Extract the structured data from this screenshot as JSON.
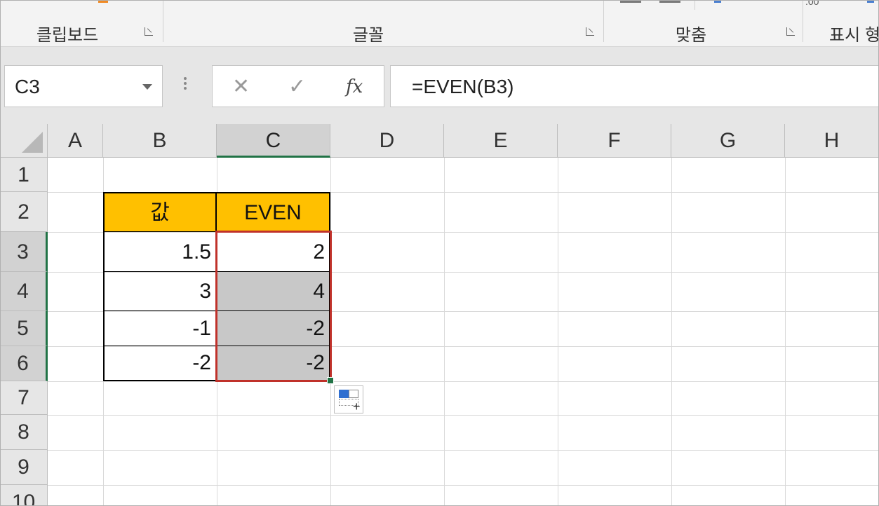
{
  "ribbon": {
    "groups": [
      {
        "label": "클립보드"
      },
      {
        "label": "글꼴"
      },
      {
        "label": "맞춤"
      },
      {
        "label": "표시 형"
      }
    ],
    "partial_text": ".00"
  },
  "formula_bar": {
    "name_box": "C3",
    "cancel_icon": "✕",
    "enter_icon": "✓",
    "fx_label": "fx",
    "formula": "=EVEN(B3)"
  },
  "columns": [
    "A",
    "B",
    "C",
    "D",
    "E",
    "F",
    "G",
    "H"
  ],
  "rows": [
    "1",
    "2",
    "3",
    "4",
    "5",
    "6",
    "7",
    "8",
    "9",
    "10"
  ],
  "table": {
    "headers": [
      "값",
      "EVEN"
    ],
    "values": [
      {
        "value": "1.5",
        "even": "2"
      },
      {
        "value": "3",
        "even": "4"
      },
      {
        "value": "-1",
        "even": "-2"
      },
      {
        "value": "-2",
        "even": "-2"
      }
    ]
  },
  "selection": {
    "active_cell": "C3",
    "range": "C3:C6"
  },
  "colors": {
    "header_fill": "#ffc000",
    "selection_border": "#c0312a",
    "selected_fill": "#c8c8c8",
    "excel_green": "#217346"
  }
}
